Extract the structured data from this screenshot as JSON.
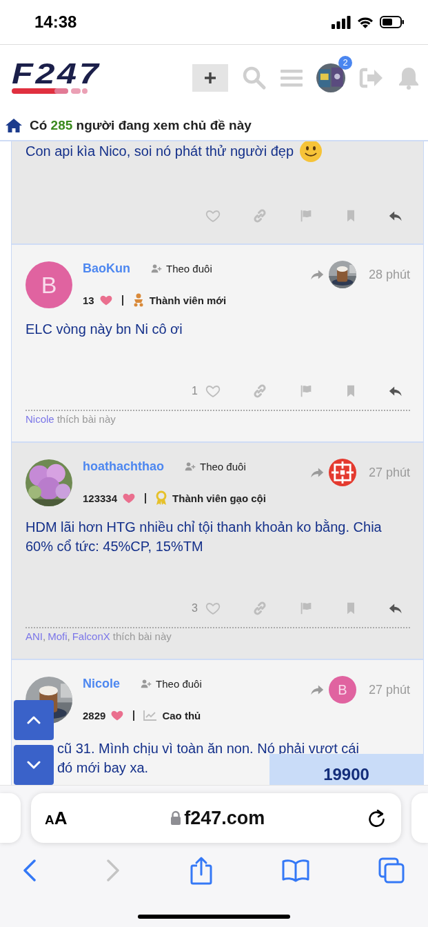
{
  "status_bar": {
    "time": "14:38"
  },
  "site_header": {
    "logo": "F247",
    "notification_count": "2"
  },
  "viewers": {
    "prefix": "Có",
    "count": "285",
    "suffix": "người đang xem chủ đề này"
  },
  "posts": [
    {
      "kind": "partial",
      "shaded": true,
      "body": "Con api kìa Nico, soi nó phát thử người đẹp",
      "body_emoji": {
        "kind": "slight_smile"
      }
    },
    {
      "kind": "full",
      "shaded": false,
      "author": "BaoKun",
      "avatar": {
        "kind": "letter",
        "letter": "B",
        "color": "#e063a0"
      },
      "follow_label": "Theo đuôi",
      "reply_to_avatar": {
        "kind": "picture"
      },
      "time": "28 phút",
      "hearts": "13",
      "rank_badge": {
        "kind": "newbie",
        "label": "Thành viên mới"
      },
      "body": "ELC vòng này bn Ni cô ơi",
      "like_count": "1",
      "likers": [
        {
          "name": "Nicole"
        }
      ],
      "likes_suffix": "thích bài này"
    },
    {
      "kind": "full",
      "shaded": true,
      "author": "hoathachthao",
      "avatar": {
        "kind": "picture"
      },
      "follow_label": "Theo đuôi",
      "reply_to_avatar": {
        "kind": "symbol"
      },
      "time": "27 phút",
      "hearts": "123334",
      "rank_badge": {
        "kind": "veteran",
        "label": "Thành viên gạo cội"
      },
      "body": "HDM lãi hơn HTG nhiều chỉ tội thanh khoản ko bằng. Chia 60% cổ tức: 45%CP, 15%TM",
      "like_count": "3",
      "likers": [
        {
          "name": "ANI",
          "separator": ","
        },
        {
          "name": "Mofi",
          "separator": ","
        },
        {
          "name": "FalconX"
        }
      ],
      "likes_suffix": "thích bài này"
    },
    {
      "kind": "cut",
      "shaded": false,
      "author": "Nicole",
      "avatar": {
        "kind": "picture"
      },
      "follow_label": "Theo đuôi",
      "reply_to_avatar": {
        "kind": "letter",
        "letter": "B",
        "color": "#e063a0"
      },
      "time": "27 phút",
      "hearts": "2829",
      "rank_badge": {
        "kind": "expert",
        "label": "Cao thủ"
      },
      "body_lines": [
        "cũ 31. Mình chịu vì toàn ăn non. Nó phải vượt cái",
        "đó mới bay xa."
      ]
    }
  ],
  "price_box": {
    "value": "19900"
  },
  "browser": {
    "text_size_label": "AA",
    "url": "f247.com",
    "back_disabled": false,
    "forward_disabled": true
  }
}
